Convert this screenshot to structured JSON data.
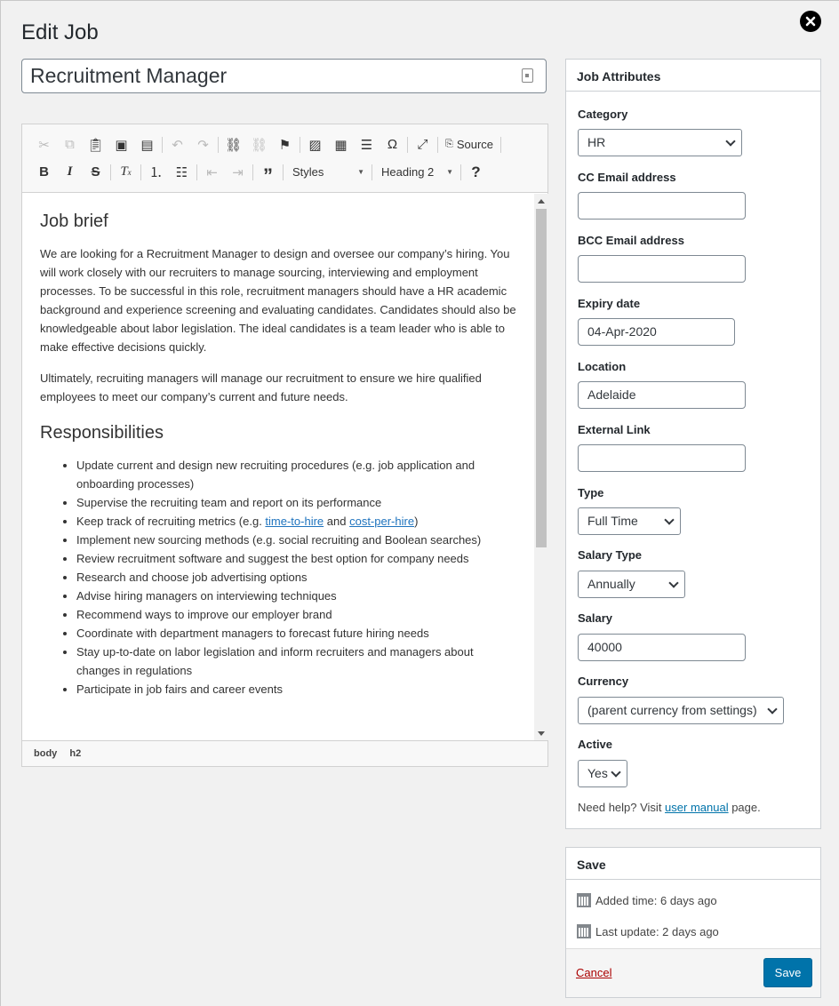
{
  "page": {
    "title": "Edit Job"
  },
  "job_title": "Recruitment Manager",
  "toolbar": {
    "source_label": "Source",
    "styles_label": "Styles",
    "format_label": "Heading 2",
    "help_label": "?"
  },
  "content": {
    "heading1": "Job brief",
    "para1": "We are looking for a Recruitment Manager to design and oversee our company’s hiring. You will work closely with our recruiters to manage sourcing, interviewing and employment processes. To be successful in this role, recruitment managers should have a HR academic background and experience screening and evaluating candidates. Candidates should also be knowledgeable about labor legislation. The ideal candidates is a team leader who is able to make effective decisions quickly.",
    "para2": "Ultimately, recruiting managers will manage our recruitment to ensure we hire qualified employees to meet our company’s current and future needs.",
    "heading2": "Responsibilities",
    "bullets": [
      "Update current and design new recruiting procedures (e.g. job application and onboarding processes)",
      "Supervise the recruiting team and report on its performance",
      "Implement new sourcing methods (e.g. social recruiting and Boolean searches)",
      "Review recruitment software and suggest the best option for company needs",
      "Research and choose job advertising options",
      "Advise hiring managers on interviewing techniques",
      "Recommend ways to improve our employer brand",
      "Coordinate with department managers to forecast future hiring needs",
      "Stay up-to-date on labor legislation and inform recruiters and managers about changes in regulations",
      "Participate in job fairs and career events"
    ],
    "metrics_bullet": {
      "prefix": "Keep track of recruiting metrics (e.g. ",
      "link1": "time-to-hire",
      "middle": " and ",
      "link2": "cost-per-hire",
      "suffix": ")"
    }
  },
  "pathbar": [
    "body",
    "h2"
  ],
  "attributes": {
    "title": "Job Attributes",
    "category": {
      "label": "Category",
      "value": "HR"
    },
    "cc_email": {
      "label": "CC Email address",
      "value": ""
    },
    "bcc_email": {
      "label": "BCC Email address",
      "value": ""
    },
    "expiry": {
      "label": "Expiry date",
      "value": "04-Apr-2020"
    },
    "location": {
      "label": "Location",
      "value": "Adelaide"
    },
    "external_link": {
      "label": "External Link",
      "value": ""
    },
    "type": {
      "label": "Type",
      "value": "Full Time"
    },
    "salary_type": {
      "label": "Salary Type",
      "value": "Annually"
    },
    "salary": {
      "label": "Salary",
      "value": "40000"
    },
    "currency": {
      "label": "Currency",
      "value": "(parent currency from settings)"
    },
    "active": {
      "label": "Active",
      "value": "Yes"
    },
    "help_prefix": "Need help? Visit ",
    "help_link": "user manual",
    "help_suffix": " page."
  },
  "save_box": {
    "title": "Save",
    "added": "Added time: 6 days ago",
    "updated": "Last update: 2 days ago",
    "cancel": "Cancel",
    "save": "Save"
  }
}
